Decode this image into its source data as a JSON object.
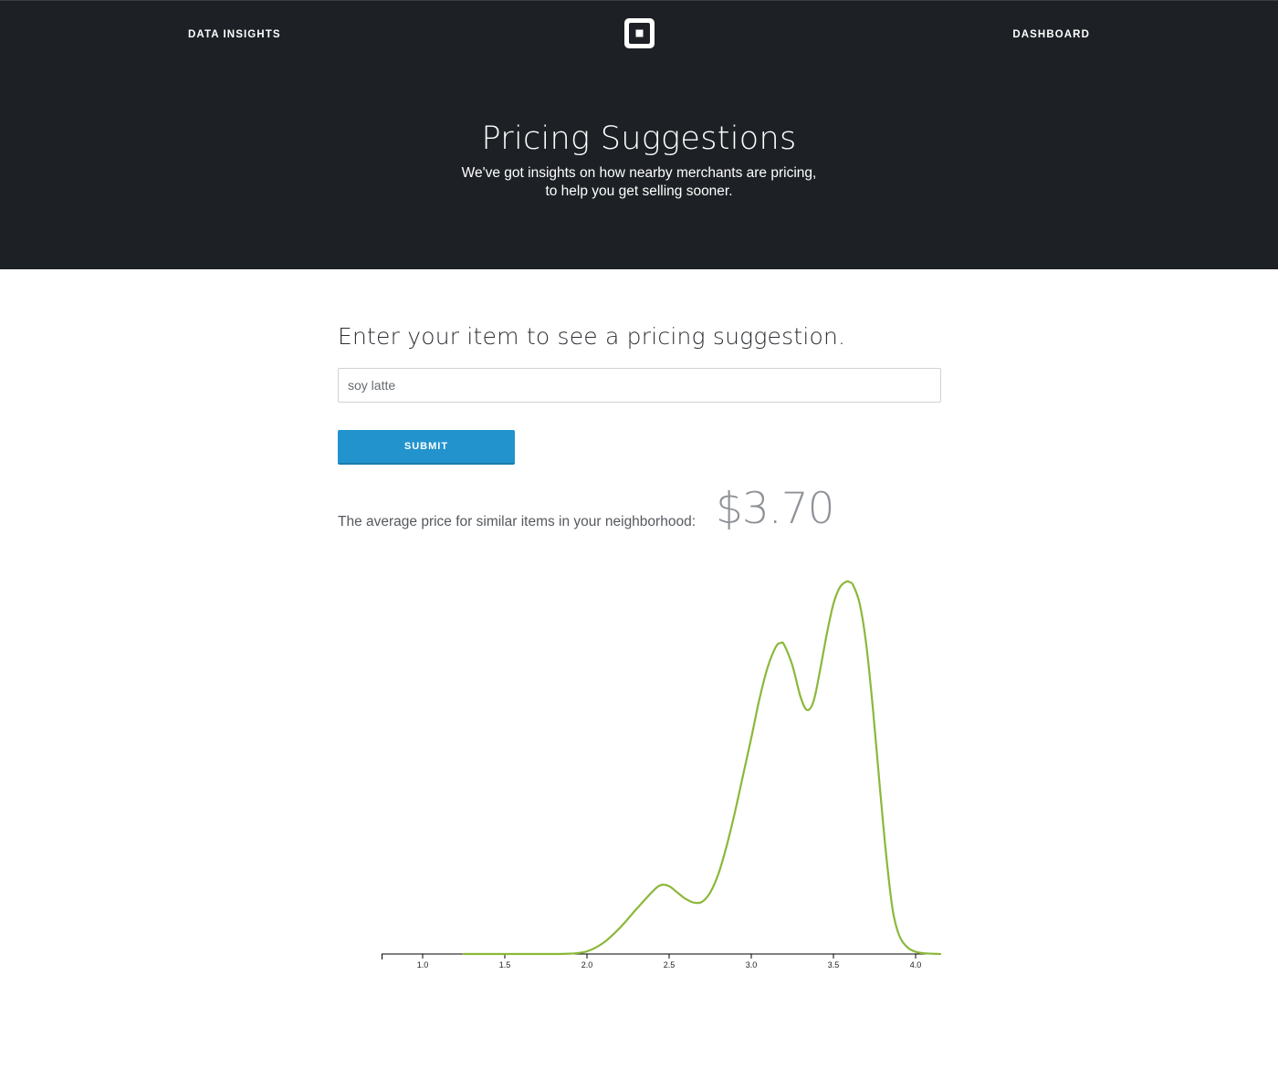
{
  "header": {
    "left_link": "DATA INSIGHTS",
    "right_link": "DASHBOARD",
    "logo_icon": "square-logo-icon",
    "background": "#1d2125"
  },
  "hero": {
    "title": "Pricing Suggestions",
    "subtitle_line1": "We've got insights on how nearby merchants are pricing,",
    "subtitle_line2": "to help you get selling sooner."
  },
  "form": {
    "prompt": "Enter your item to see a pricing suggestion.",
    "item_value": "soy latte",
    "submit_label": "SUBMIT",
    "accent": "#2293cd"
  },
  "result": {
    "avg_label": "The average price for similar items in your neighborhood:",
    "avg_price": "$3.70"
  },
  "chart_data": {
    "type": "line",
    "title": "",
    "xlabel": "",
    "ylabel": "",
    "xlim": [
      0.75,
      4.15
    ],
    "ylim": [
      0,
      1.0
    ],
    "xticks": [
      "1.0",
      "1.5",
      "2.0",
      "2.5",
      "3.0",
      "3.5",
      "4.0"
    ],
    "grid": false,
    "line_color": "#8bb83a",
    "series": [
      {
        "x": [
          1.25,
          1.5,
          1.75,
          1.9,
          2.0,
          2.1,
          2.2,
          2.3,
          2.4,
          2.45,
          2.5,
          2.55,
          2.6,
          2.65,
          2.7,
          2.75,
          2.8,
          2.85,
          2.9,
          2.95,
          3.0,
          3.05,
          3.1,
          3.15,
          3.18,
          3.2,
          3.25,
          3.3,
          3.34,
          3.38,
          3.42,
          3.46,
          3.5,
          3.54,
          3.58,
          3.6,
          3.62,
          3.66,
          3.7,
          3.74,
          3.78,
          3.82,
          3.86,
          3.9,
          3.95,
          4.0,
          4.05,
          4.15
        ],
        "y": [
          0.0,
          0.0,
          0.0,
          0.001,
          0.007,
          0.03,
          0.07,
          0.12,
          0.168,
          0.185,
          0.182,
          0.165,
          0.148,
          0.138,
          0.14,
          0.165,
          0.215,
          0.29,
          0.38,
          0.48,
          0.58,
          0.685,
          0.77,
          0.825,
          0.835,
          0.83,
          0.775,
          0.69,
          0.655,
          0.68,
          0.765,
          0.86,
          0.94,
          0.985,
          1.0,
          0.998,
          0.99,
          0.94,
          0.83,
          0.66,
          0.46,
          0.27,
          0.12,
          0.05,
          0.018,
          0.006,
          0.002,
          0.0
        ]
      }
    ]
  }
}
